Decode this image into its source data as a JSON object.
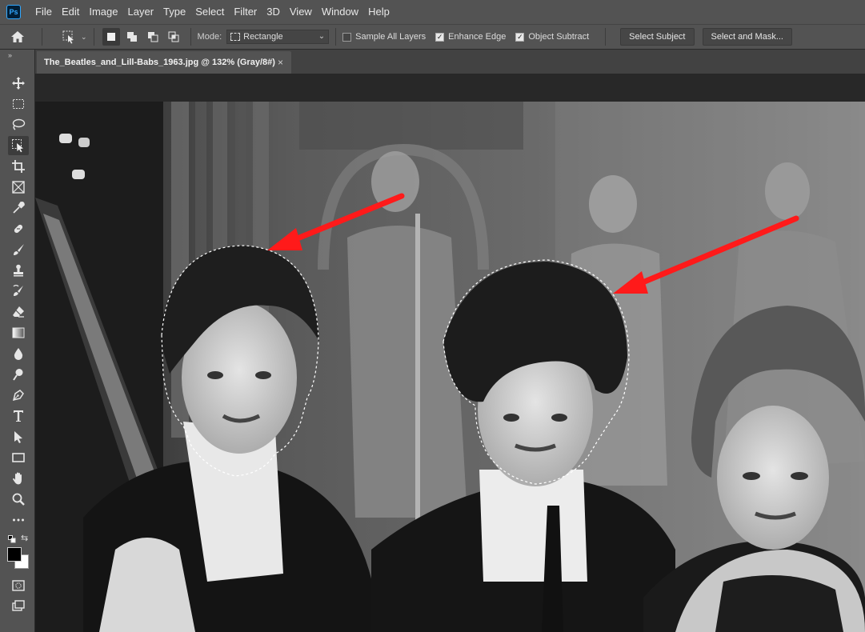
{
  "app": {
    "logo_text": "Ps"
  },
  "menu": {
    "items": [
      "File",
      "Edit",
      "Image",
      "Layer",
      "Type",
      "Select",
      "Filter",
      "3D",
      "View",
      "Window",
      "Help"
    ]
  },
  "options": {
    "mode_label": "Mode:",
    "mode_value": "Rectangle",
    "sample_all_layers": {
      "label": "Sample All Layers",
      "checked": false
    },
    "enhance_edge": {
      "label": "Enhance Edge",
      "checked": true
    },
    "object_subtract": {
      "label": "Object Subtract",
      "checked": true
    },
    "select_subject_label": "Select Subject",
    "select_and_mask_label": "Select and Mask..."
  },
  "document": {
    "tab_title": "The_Beatles_and_Lill-Babs_1963.jpg @ 132% (Gray/8#)",
    "close_glyph": "×"
  },
  "toolbar": {
    "grip": "»",
    "tools": [
      "move-tool",
      "marquee-tool",
      "lasso-tool",
      "object-selection-tool",
      "crop-tool",
      "frame-tool",
      "eyedropper-tool",
      "healing-brush-tool",
      "brush-tool",
      "clone-stamp-tool",
      "history-brush-tool",
      "eraser-tool",
      "gradient-tool",
      "blur-tool",
      "dodge-tool",
      "pen-tool",
      "type-tool",
      "path-selection-tool",
      "rectangle-tool",
      "hand-tool",
      "zoom-tool",
      "more-tools"
    ],
    "active_tool": "object-selection-tool",
    "foreground_color": "#000000",
    "background_color": "#ffffff"
  },
  "colors": {
    "annotation_arrow": "#ff1a1a",
    "ui_panel": "#535353",
    "ui_dark": "#282828"
  }
}
